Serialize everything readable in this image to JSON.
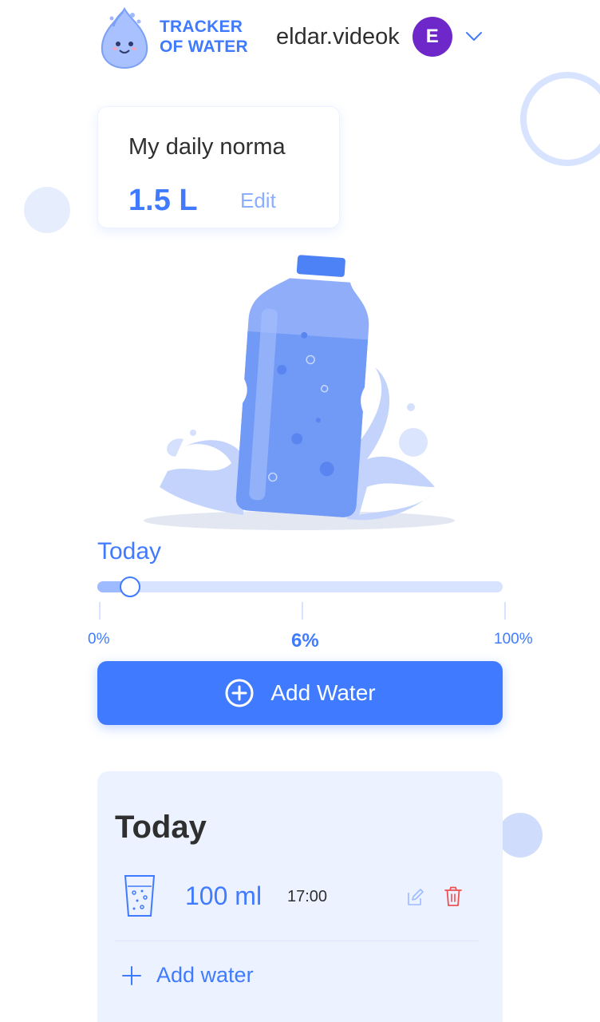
{
  "header": {
    "logo_line1": "TRACKER",
    "logo_line2": "OF WATER",
    "user_name": "eldar.videok",
    "avatar_initial": "E"
  },
  "daily_norma": {
    "title": "My daily norma",
    "value": "1.5 L",
    "edit_label": "Edit"
  },
  "progress": {
    "label": "Today",
    "percent": 6,
    "min_label": "0%",
    "current_label": "6%",
    "max_label": "100%"
  },
  "add_button": {
    "label": "Add Water"
  },
  "today_log": {
    "title": "Today",
    "entries": [
      {
        "amount": "100 ml",
        "time": "17:00"
      }
    ],
    "add_link_label": "Add water"
  },
  "colors": {
    "accent": "#407bff",
    "accent_light": "#9ebbff",
    "card_bg": "#ecf2ff",
    "avatar": "#6e27c9",
    "delete": "#ef5050"
  },
  "icons": {
    "avatar_dropdown": "chevron-down-icon",
    "add": "plus-circle-icon",
    "entry": "glass-icon",
    "edit": "pencil-icon",
    "delete": "trash-icon",
    "add_link": "plus-icon"
  }
}
